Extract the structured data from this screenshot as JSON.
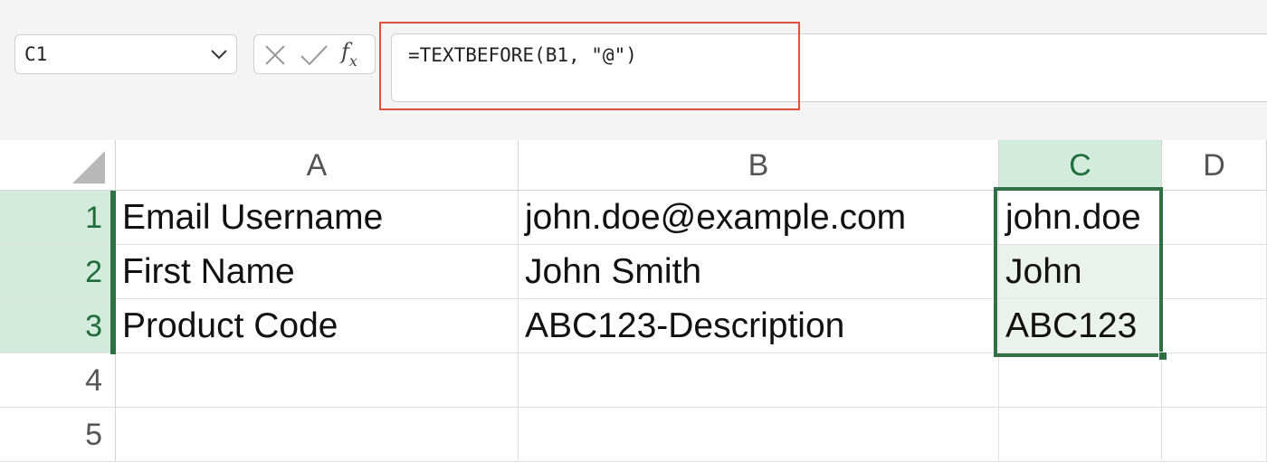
{
  "name_box": {
    "value": "C1"
  },
  "formula_bar": {
    "cancel_icon": "x-icon",
    "confirm_icon": "checkmark-icon",
    "insert_function_label": "fx",
    "formula": "=TEXTBEFORE(B1, \"@\")"
  },
  "columns": [
    {
      "label": "A"
    },
    {
      "label": "B"
    },
    {
      "label": "C",
      "selected": true
    },
    {
      "label": "D"
    }
  ],
  "rows": [
    {
      "label": "1",
      "cells": [
        "Email Username",
        "john.doe@example.com",
        "john.doe",
        ""
      ]
    },
    {
      "label": "2",
      "cells": [
        "First Name",
        "John Smith",
        "John",
        ""
      ]
    },
    {
      "label": "3",
      "cells": [
        "Product Code",
        "ABC123-Description",
        "ABC123",
        ""
      ]
    },
    {
      "label": "4",
      "cells": [
        "",
        "",
        "",
        ""
      ]
    },
    {
      "label": "5",
      "cells": [
        "",
        "",
        "",
        ""
      ]
    }
  ],
  "selection": {
    "active_cell": "C1",
    "range": "C1:C3"
  },
  "colors": {
    "selection_accent": "#2f7045",
    "header_selected_bg": "#d3ebdc",
    "range_fill": "#ebf1ed",
    "callout_outline": "#e2513b"
  }
}
